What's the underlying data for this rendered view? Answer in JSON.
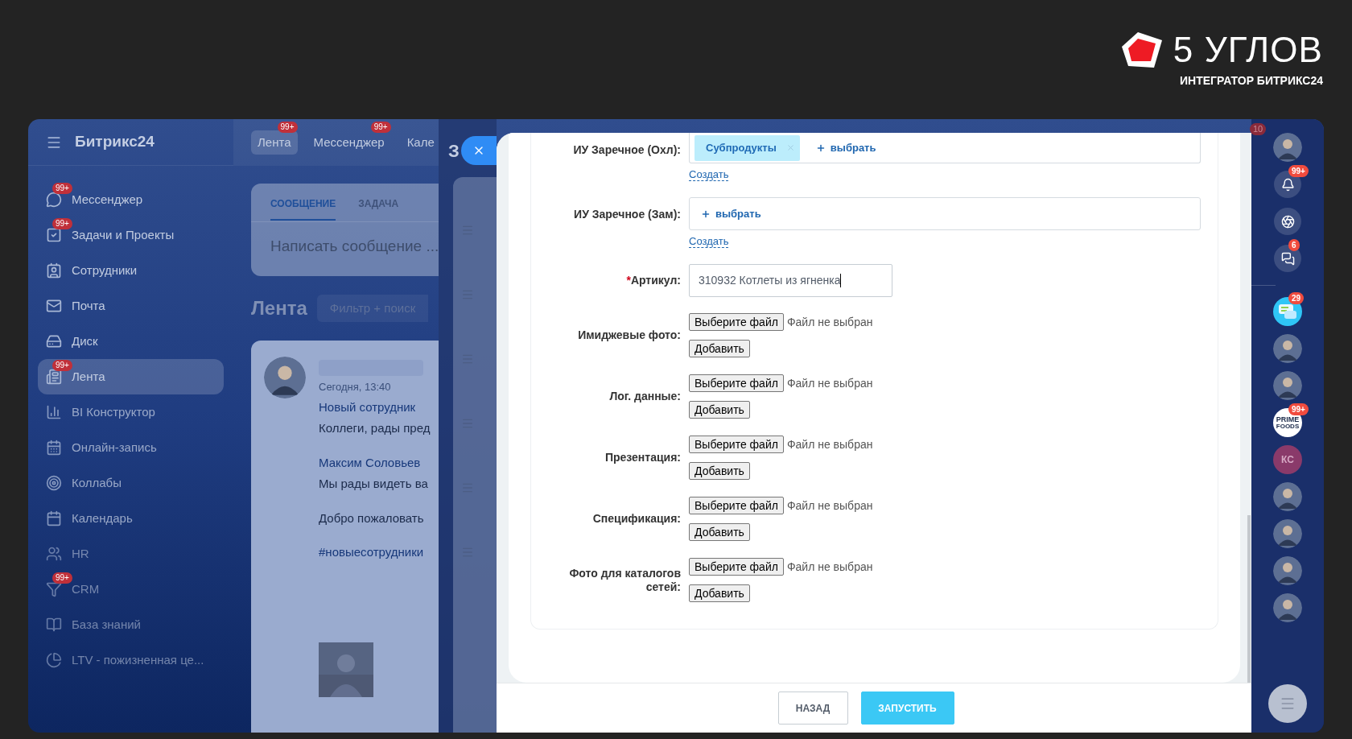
{
  "logo": {
    "title": "5 УГЛОВ",
    "subtitle": "ИНТЕГРАТОР БИТРИКС24"
  },
  "sidebar": {
    "brand": "Битрикс24",
    "items": [
      {
        "label": "Мессенджер",
        "badge": "99+",
        "selected": false
      },
      {
        "label": "Задачи и Проекты",
        "badge": "99+",
        "selected": false
      },
      {
        "label": "Сотрудники",
        "selected": false
      },
      {
        "label": "Почта",
        "selected": false
      },
      {
        "label": "Диск",
        "selected": false
      },
      {
        "label": "Лента",
        "badge": "99+",
        "selected": true
      },
      {
        "label": "BI Конструктор",
        "selected": false
      },
      {
        "label": "Онлайн-запись",
        "selected": false
      },
      {
        "label": "Коллабы",
        "selected": false
      },
      {
        "label": "Календарь",
        "selected": false
      },
      {
        "label": "HR",
        "selected": false
      },
      {
        "label": "CRM",
        "badge": "99+",
        "selected": false
      },
      {
        "label": "База знаний",
        "selected": false
      },
      {
        "label": "LTV - пожизненная це...",
        "selected": false
      }
    ]
  },
  "top_nav": [
    {
      "label": "Лента",
      "badge": "99+",
      "selected": true
    },
    {
      "label": "Мессенджер",
      "badge": "99+",
      "selected": false
    },
    {
      "label": "Кале",
      "selected": false
    }
  ],
  "composer": {
    "tabs": [
      {
        "label": "СООБЩЕНИЕ",
        "selected": true
      },
      {
        "label": "ЗАДАЧА",
        "selected": false
      }
    ],
    "placeholder": "Написать сообщение ..."
  },
  "feed": {
    "title": "Лента",
    "filter_placeholder": "Фильтр + поиск",
    "post": {
      "time": "Сегодня, 13:40",
      "subject": "Новый сотрудник",
      "text": "Коллеги, рады пред",
      "mention": "Максим Соловьев",
      "line2": "Мы рады видеть ва",
      "line3": "Добро пожаловать",
      "hashtag": "#новыесотрудники"
    }
  },
  "slider": {
    "title_fragment": "З"
  },
  "form": {
    "rows": [
      {
        "kind": "selector",
        "label": "ИУ Заречное (Охл):",
        "tags": [
          "Субпродукты"
        ],
        "add": "выбрать",
        "create": "Создать"
      },
      {
        "kind": "selector",
        "label": "ИУ Заречное (Зам):",
        "add": "выбрать",
        "create": "Создать"
      },
      {
        "kind": "text",
        "label": "Артикул:",
        "required": true,
        "required_mark": "*",
        "value": "310932 Котлеты из ягненка"
      },
      {
        "kind": "file",
        "label": "Имиджевые фото:",
        "choose": "Выберите файл",
        "status": "Файл не выбран",
        "add": "Добавить"
      },
      {
        "kind": "file",
        "label": "Лог. данные:",
        "choose": "Выберите файл",
        "status": "Файл не выбран",
        "add": "Добавить"
      },
      {
        "kind": "file",
        "label": "Презентация:",
        "choose": "Выберите файл",
        "status": "Файл не выбран",
        "add": "Добавить"
      },
      {
        "kind": "file",
        "label": "Спецификация:",
        "choose": "Выберите файл",
        "status": "Файл не выбран",
        "add": "Добавить"
      },
      {
        "kind": "file",
        "label": "Фото для каталогов сетей:",
        "choose": "Выберите файл",
        "status": "Файл не выбран",
        "add": "Добавить"
      }
    ]
  },
  "footer": {
    "buttons": [
      {
        "label": "НАЗАД",
        "kind": "secondary"
      },
      {
        "label": "ЗАПУСТИТЬ",
        "kind": "primary"
      }
    ]
  },
  "right_bar": {
    "top_badge": "10",
    "items": [
      {
        "kind": "avatar"
      },
      {
        "kind": "bell",
        "badge": "99+"
      },
      {
        "kind": "spiral"
      },
      {
        "kind": "chats",
        "badge": "6"
      },
      {
        "kind": "divider"
      },
      {
        "kind": "chat-app",
        "badge": "29"
      },
      {
        "kind": "avatar"
      },
      {
        "kind": "avatar"
      },
      {
        "kind": "brand",
        "line1": "PRIME",
        "line2": "FOODS",
        "badge": "99+"
      },
      {
        "kind": "initials",
        "text": "КС"
      },
      {
        "kind": "avatar"
      },
      {
        "kind": "avatar"
      },
      {
        "kind": "avatar"
      },
      {
        "kind": "avatar"
      }
    ]
  }
}
